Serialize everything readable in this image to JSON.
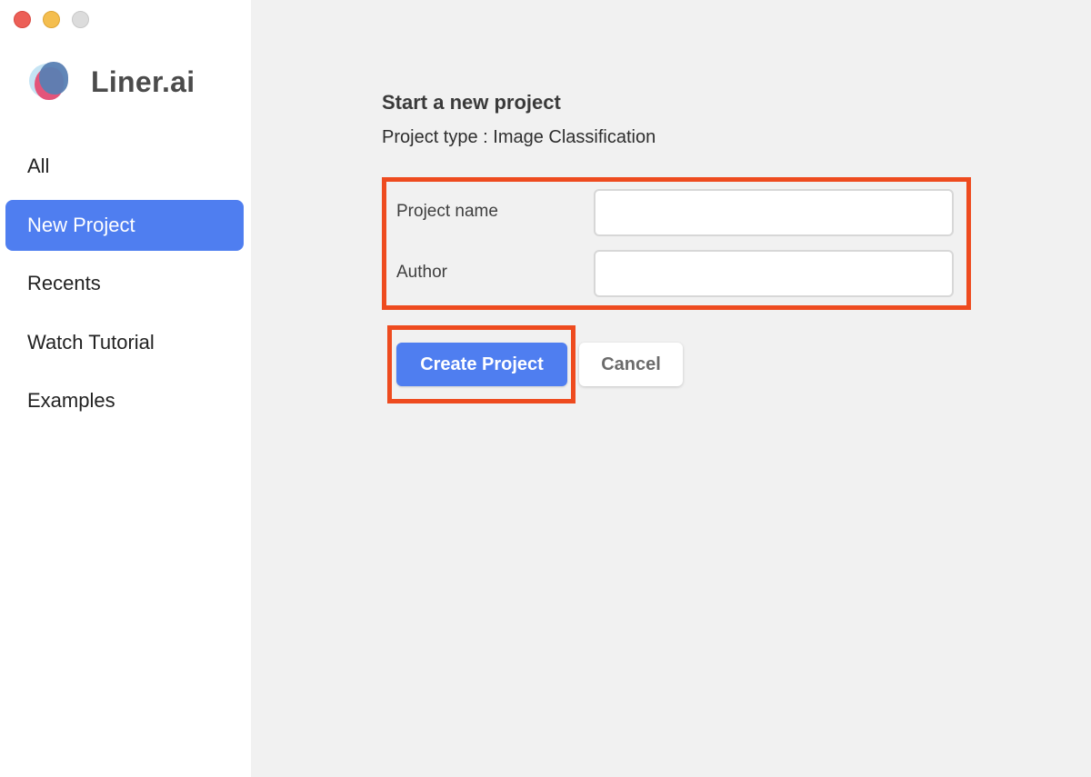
{
  "window": {
    "controls": [
      "close",
      "minimize",
      "zoom"
    ]
  },
  "brand": {
    "name": "Liner.ai",
    "logo_icon": "liner-logo-icon"
  },
  "sidebar": {
    "items": [
      {
        "label": "All",
        "active": false
      },
      {
        "label": "New Project",
        "active": true
      },
      {
        "label": "Recents",
        "active": false
      },
      {
        "label": "Watch Tutorial",
        "active": false
      },
      {
        "label": "Examples",
        "active": false
      }
    ]
  },
  "main": {
    "title": "Start a new project",
    "project_type": "Project type : Image Classification",
    "form": {
      "project_name_label": "Project name",
      "project_name_value": "",
      "author_label": "Author",
      "author_value": ""
    },
    "buttons": {
      "create": "Create Project",
      "cancel": "Cancel"
    }
  },
  "colors": {
    "accent": "#4f7ef0",
    "highlight_border": "#ee4b1f",
    "background": "#f1f1f1",
    "sidebar": "#ffffff"
  }
}
